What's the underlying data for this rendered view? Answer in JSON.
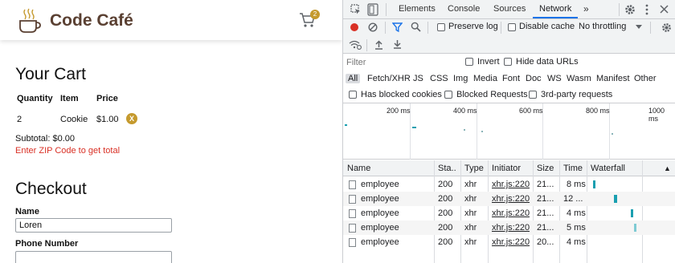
{
  "site": {
    "brand": "Code Café",
    "cart_count": "2",
    "cart_title": "Your Cart",
    "cart_headers": {
      "quantity": "Quantity",
      "item": "Item",
      "price": "Price"
    },
    "cart_rows": [
      {
        "quantity": "2",
        "item": "Cookie",
        "price": "$1.00",
        "remove": "X"
      }
    ],
    "subtotal": "Subtotal: $0.00",
    "zip_message": "Enter ZIP Code to get total",
    "checkout_title": "Checkout",
    "fields": [
      {
        "label": "Name",
        "value": "Loren"
      },
      {
        "label": "Phone Number",
        "value": ""
      }
    ],
    "colors": {
      "brand": "#5a4032",
      "accent": "#c59a2e",
      "error": "#d93025"
    }
  },
  "devtools": {
    "tabs": [
      "Elements",
      "Console",
      "Sources",
      "Network"
    ],
    "active_tab": "Network",
    "more_tabs": "»",
    "toolbar": {
      "preserve_log": "Preserve log",
      "disable_cache": "Disable cache",
      "throttling": "No throttling"
    },
    "filter": {
      "placeholder": "Filter",
      "invert": "Invert",
      "hide_data_urls": "Hide data URLs"
    },
    "types": [
      "All",
      "Fetch/XHR",
      "JS",
      "CSS",
      "Img",
      "Media",
      "Font",
      "Doc",
      "WS",
      "Wasm",
      "Manifest",
      "Other"
    ],
    "blocked": {
      "has_blocked_cookies": "Has blocked cookies",
      "blocked_requests": "Blocked Requests",
      "third_party": "3rd-party requests"
    },
    "overview_ticks": [
      "200 ms",
      "400 ms",
      "600 ms",
      "800 ms",
      "1000 ms"
    ],
    "columns": [
      "Name",
      "Sta..",
      "Type",
      "Initiator",
      "Size",
      "Time",
      "Waterfall"
    ],
    "sort_indicator": "▲",
    "requests": [
      {
        "name": "employee",
        "status": "200",
        "type": "xhr",
        "initiator": "xhr.js:220",
        "size": "21...",
        "time": "8 ms"
      },
      {
        "name": "employee",
        "status": "200",
        "type": "xhr",
        "initiator": "xhr.js:220",
        "size": "21...",
        "time": "12 ..."
      },
      {
        "name": "employee",
        "status": "200",
        "type": "xhr",
        "initiator": "xhr.js:220",
        "size": "21...",
        "time": "4 ms"
      },
      {
        "name": "employee",
        "status": "200",
        "type": "xhr",
        "initiator": "xhr.js:220",
        "size": "21...",
        "time": "5 ms"
      },
      {
        "name": "employee",
        "status": "200",
        "type": "xhr",
        "initiator": "xhr.js:220",
        "size": "20...",
        "time": "4 ms"
      }
    ],
    "colors": {
      "active_tab": "#1a73e8",
      "record": "#d93025",
      "waterfall": "#1a9fb0"
    }
  }
}
